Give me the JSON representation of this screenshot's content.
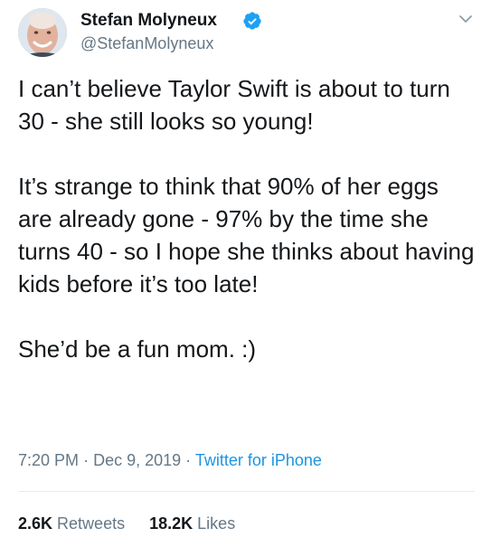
{
  "tweet": {
    "display_name": "Stefan Molyneux",
    "handle": "@StefanMolyneux",
    "verified": true,
    "paragraphs": [
      "I can’t believe Taylor Swift is about to turn 30 - she still looks so young!",
      "It’s strange to think that 90% of her eggs are already gone - 97% by the time she turns 40 - so I hope she thinks about having kids before it’s too late!",
      "She’d be a fun mom. :)"
    ],
    "time": "7:20 PM",
    "date": "Dec 9, 2019",
    "separator": "·",
    "source": "Twitter for iPhone",
    "retweets_count": "2.6K",
    "retweets_label": "Retweets",
    "likes_count": "18.2K",
    "likes_label": "Likes"
  },
  "icons": {
    "verified": "verified-badge-icon",
    "caret": "chevron-down-icon",
    "avatar": "profile-photo"
  },
  "colors": {
    "text": "#14171a",
    "secondary": "#657786",
    "accent": "#1b95e0",
    "verified_badge": "#1da1f2",
    "divider": "#e6ecf0"
  }
}
